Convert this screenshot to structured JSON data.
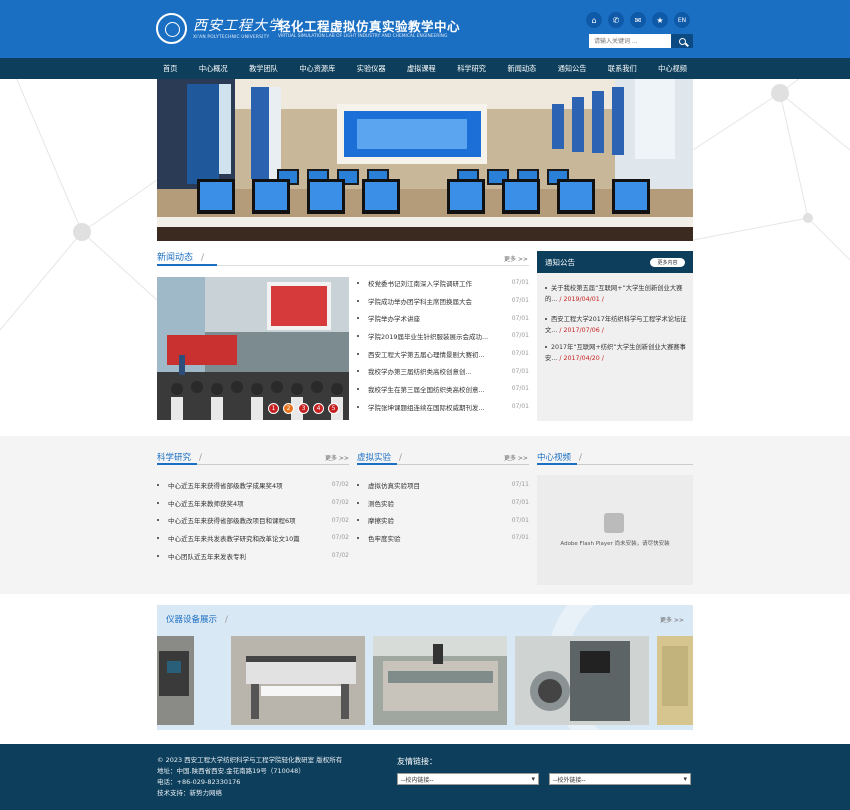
{
  "header": {
    "university_name": "西安工程大学",
    "university_en": "XI'AN POLYTECHNIC UNIVERSITY",
    "center_title": "轻化工程虚拟仿真实验教学中心",
    "center_en": "VIRTUAL SIMULATION LAB OF LIGHT INDUSTRY AND CHEMICAL ENGINEERING",
    "lang_label": "EN",
    "icons": [
      "home-icon",
      "wechat-icon",
      "mail-icon",
      "star-icon"
    ],
    "search_placeholder": "请输入关键词 ...",
    "brand_color": "#1b6fc2",
    "nav_color": "#0d3f5c"
  },
  "nav": [
    "首页",
    "中心概况",
    "教学团队",
    "中心资源库",
    "实验仪器",
    "虚拟课程",
    "科学研究",
    "新闻动态",
    "通知公告",
    "联系我们",
    "中心视频"
  ],
  "news": {
    "title": "新闻动态",
    "more": "更多 >>",
    "slider_dots": [
      "1",
      "2",
      "3",
      "4",
      "5"
    ],
    "items": [
      {
        "title": "校党委书记刘江南深入学院调研工作",
        "date": "07/01"
      },
      {
        "title": "学院成功举办团学科主席团换届大会",
        "date": "07/01"
      },
      {
        "title": "学院举办学术讲座",
        "date": "07/01"
      },
      {
        "title": "学院2019届毕业生针织服装展示会成功...",
        "date": "07/01"
      },
      {
        "title": "西安工程大学第五届心理情景剧大赛初...",
        "date": "07/01"
      },
      {
        "title": "我校学办第三届纺织类高校创意创...",
        "date": "07/01"
      },
      {
        "title": "我校学生在第三届全国纺织类高校创意...",
        "date": "07/01"
      },
      {
        "title": "学院张坤课题组连续在国际权威期刊发...",
        "date": "07/01"
      }
    ]
  },
  "notice": {
    "title": "通知公告",
    "more": "更多内容",
    "items": [
      {
        "title": "关于我校第五届“互联网+”大学生创新创业大赛的...",
        "date": "/ 2019/04/01 /"
      },
      {
        "title": "西安工程大学2017年纺织科学与工程学术论坛征文...",
        "date": "/ 2017/07/06 /"
      },
      {
        "title": "2017年“互联网+纺织”大学生创新创业大赛赛事安...",
        "date": "/ 2017/04/20 /"
      }
    ]
  },
  "research": {
    "title": "科学研究",
    "more": "更多 >>",
    "items": [
      {
        "title": "中心近五年来获得省部级教学成果奖4项",
        "date": "07/02"
      },
      {
        "title": "中心近五年来教师获奖4项",
        "date": "07/02"
      },
      {
        "title": "中心近五年来获得省部级教改项目和课程6项",
        "date": "07/02"
      },
      {
        "title": "中心近五年来共发表教学研究和改革论文10篇",
        "date": "07/02"
      },
      {
        "title": "中心团队近五年来发表专利",
        "date": "07/02"
      }
    ]
  },
  "virtual": {
    "title": "虚拟实验",
    "more": "更多 >>",
    "items": [
      {
        "title": "虚拟仿真实验项目",
        "date": "07/11"
      },
      {
        "title": "测色实验",
        "date": "07/01"
      },
      {
        "title": "摩擦实验",
        "date": "07/01"
      },
      {
        "title": "色牢度实验",
        "date": "07/01"
      }
    ]
  },
  "video": {
    "title": "中心视频",
    "plugin_msg": "Adobe Flash Player 尚未安装，请尽快安装"
  },
  "equipment": {
    "title": "仪器设备展示",
    "more": "更多 >>"
  },
  "footer": {
    "copyright": "© 2023 西安工程大学纺织科学与工程学院轻化教研室 版权所有",
    "address": "地址：中国.陕西省西安.金花南路19号（710048）",
    "phone": "电话：+86-029-82330176",
    "support": "技术支持：新势力网络",
    "friend_title": "友情链接：",
    "select_internal": "--校内链接--",
    "select_external": "--校外链接--"
  }
}
